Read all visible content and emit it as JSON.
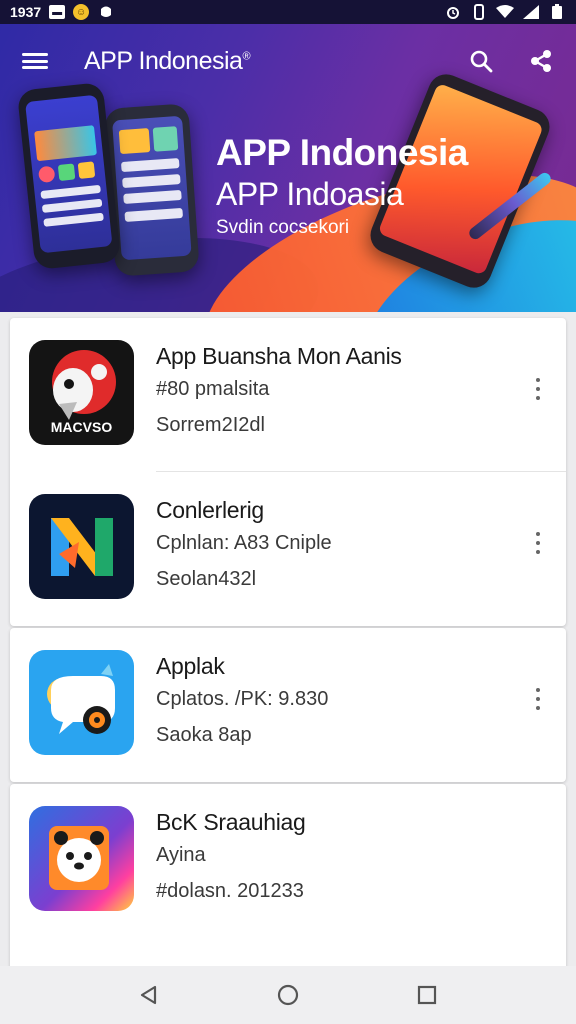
{
  "status_bar": {
    "time": "1937",
    "left_icons": [
      "message-icon",
      "emoji-icon",
      "notification-icon"
    ],
    "right_icons": [
      "alarm-icon",
      "vibrate-icon",
      "wifi-icon",
      "signal-icon",
      "battery-icon"
    ]
  },
  "header": {
    "title": "APP Indonesia",
    "title_mark": "®",
    "actions": [
      "search-icon",
      "share-icon"
    ]
  },
  "hero": {
    "title": "APP Indonesia",
    "subtitle": "APP Indoasia",
    "tagline": "Svdin cocsekori"
  },
  "apps": [
    {
      "name": "App Buansha Mon Aanis",
      "line2": "#80 pmalsita",
      "line3": "Sorrem2I2dl",
      "icon_label": "MACVSO",
      "icon": "red-bird-logo"
    },
    {
      "name": "Conlerlerig",
      "line2": "Cplnlan: A83 Cniple",
      "line3": "Seolan432l",
      "icon": "color-n-logo"
    },
    {
      "name": "Applak",
      "line2": "Cplatos. /PK: 9.830",
      "line3": "Saoka 8ap",
      "icon": "chat-bubble-logo"
    },
    {
      "name": "BcK Sraauhiag",
      "line2": "Ayina",
      "line3": "#dolasn. 201233",
      "icon": "panda-logo"
    }
  ],
  "colors": {
    "hero_start": "#2f2aa6",
    "hero_end": "#7a2a90",
    "accent_orange": "#ff5b2e",
    "accent_blue": "#27c6e8"
  },
  "nav": [
    "back-icon",
    "home-icon",
    "recents-icon"
  ]
}
